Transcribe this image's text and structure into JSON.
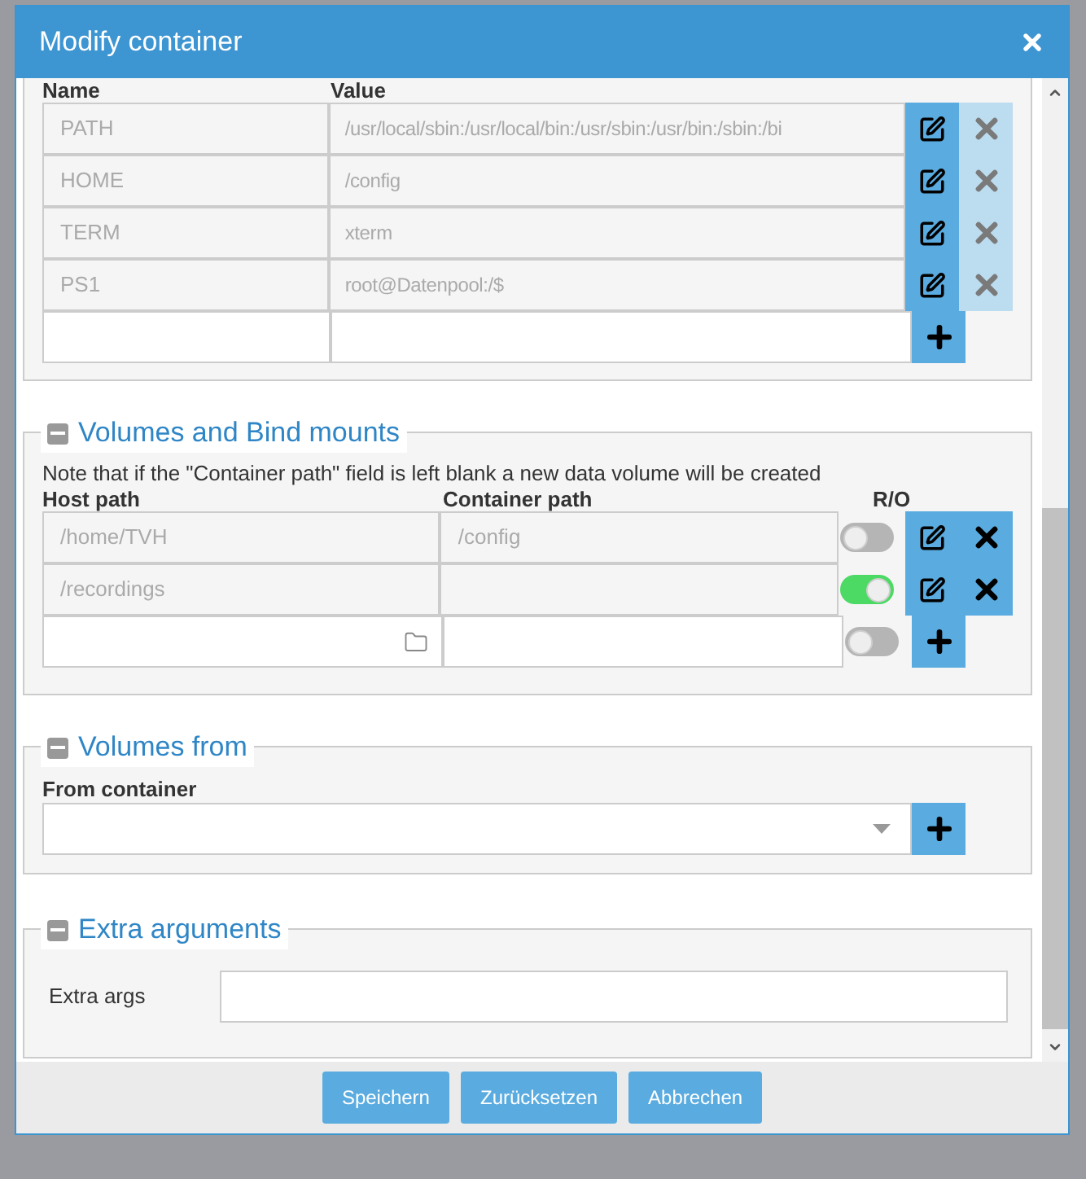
{
  "dialog": {
    "title": "Modify container"
  },
  "environment": {
    "columns": [
      "Name",
      "Value"
    ],
    "rows": [
      {
        "name": "PATH",
        "value": "/usr/local/sbin:/usr/local/bin:/usr/sbin:/usr/bin:/sbin:/bi",
        "disabled": true
      },
      {
        "name": "HOME",
        "value": "/config",
        "disabled": true
      },
      {
        "name": "TERM",
        "value": "xterm",
        "disabled": true
      },
      {
        "name": "PS1",
        "value": "root@Datenpool:/$",
        "disabled": true
      }
    ]
  },
  "volumes": {
    "title": "Volumes and Bind mounts",
    "expanded": true,
    "note": "Note that if the \"Container path\" field is left blank a new data volume will be created",
    "columns": [
      "Host path",
      "Container path",
      "R/O"
    ],
    "rows": [
      {
        "host": "/home/TVH",
        "container": "/config",
        "read_only": false,
        "disabled": false
      },
      {
        "host": "/recordings",
        "read_only": true,
        "disabled": false
      }
    ],
    "new_row": {
      "read_only": false
    }
  },
  "volumes_from": {
    "title": "Volumes from",
    "expanded": true,
    "label": "From container"
  },
  "extra_arguments": {
    "title": "Extra arguments",
    "expanded": true,
    "label": "Extra args"
  },
  "buttons": [
    "Speichern",
    "Zurücksetzen",
    "Abbrechen"
  ]
}
